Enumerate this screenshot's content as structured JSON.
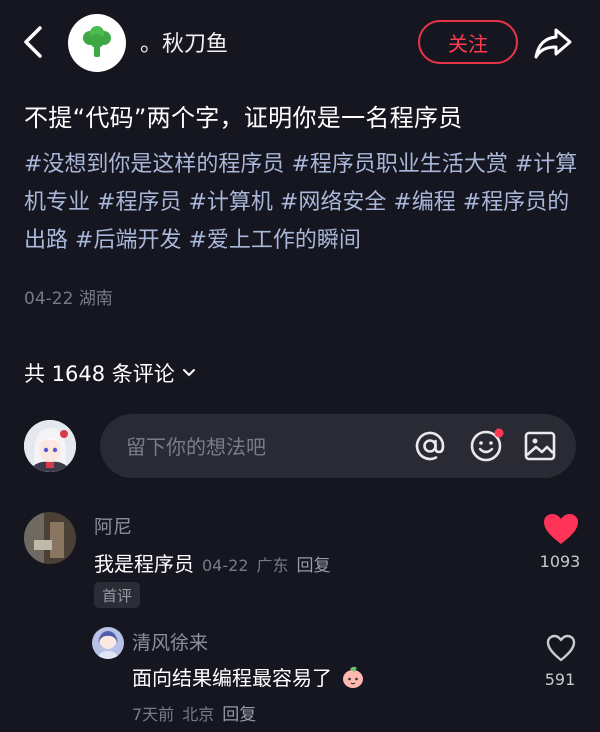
{
  "header": {
    "author_name": "。秋刀鱼",
    "follow_label": "关注"
  },
  "post": {
    "title": "不提“代码”两个字，证明你是一名程序员",
    "tags": [
      "#没想到你是这样的程序员",
      "#程序员职业生活大赏",
      "#计算机专业",
      "#程序员",
      "#计算机",
      "#网络安全",
      "#编程",
      "#程序员的出路",
      "#后端开发",
      "#爱上工作的瞬间"
    ],
    "date": "04-22",
    "location": "湖南"
  },
  "comments_section": {
    "count_label": "共 1648 条评论",
    "input_placeholder": "留下你的想法吧"
  },
  "comments": [
    {
      "user": "阿尼",
      "text": "我是程序员",
      "date": "04-22",
      "location": "广东",
      "reply_label": "回复",
      "badge": "首评",
      "likes": "1093",
      "liked": true
    }
  ],
  "replies": [
    {
      "user": "清风徐来",
      "text": "面向结果编程最容易了",
      "date": "7天前",
      "location": "北京",
      "reply_label": "回复",
      "likes": "591",
      "liked": false
    }
  ],
  "colors": {
    "background": "#161620",
    "accent_red": "#ff3b54",
    "tag_blue": "#a9b7d8"
  }
}
